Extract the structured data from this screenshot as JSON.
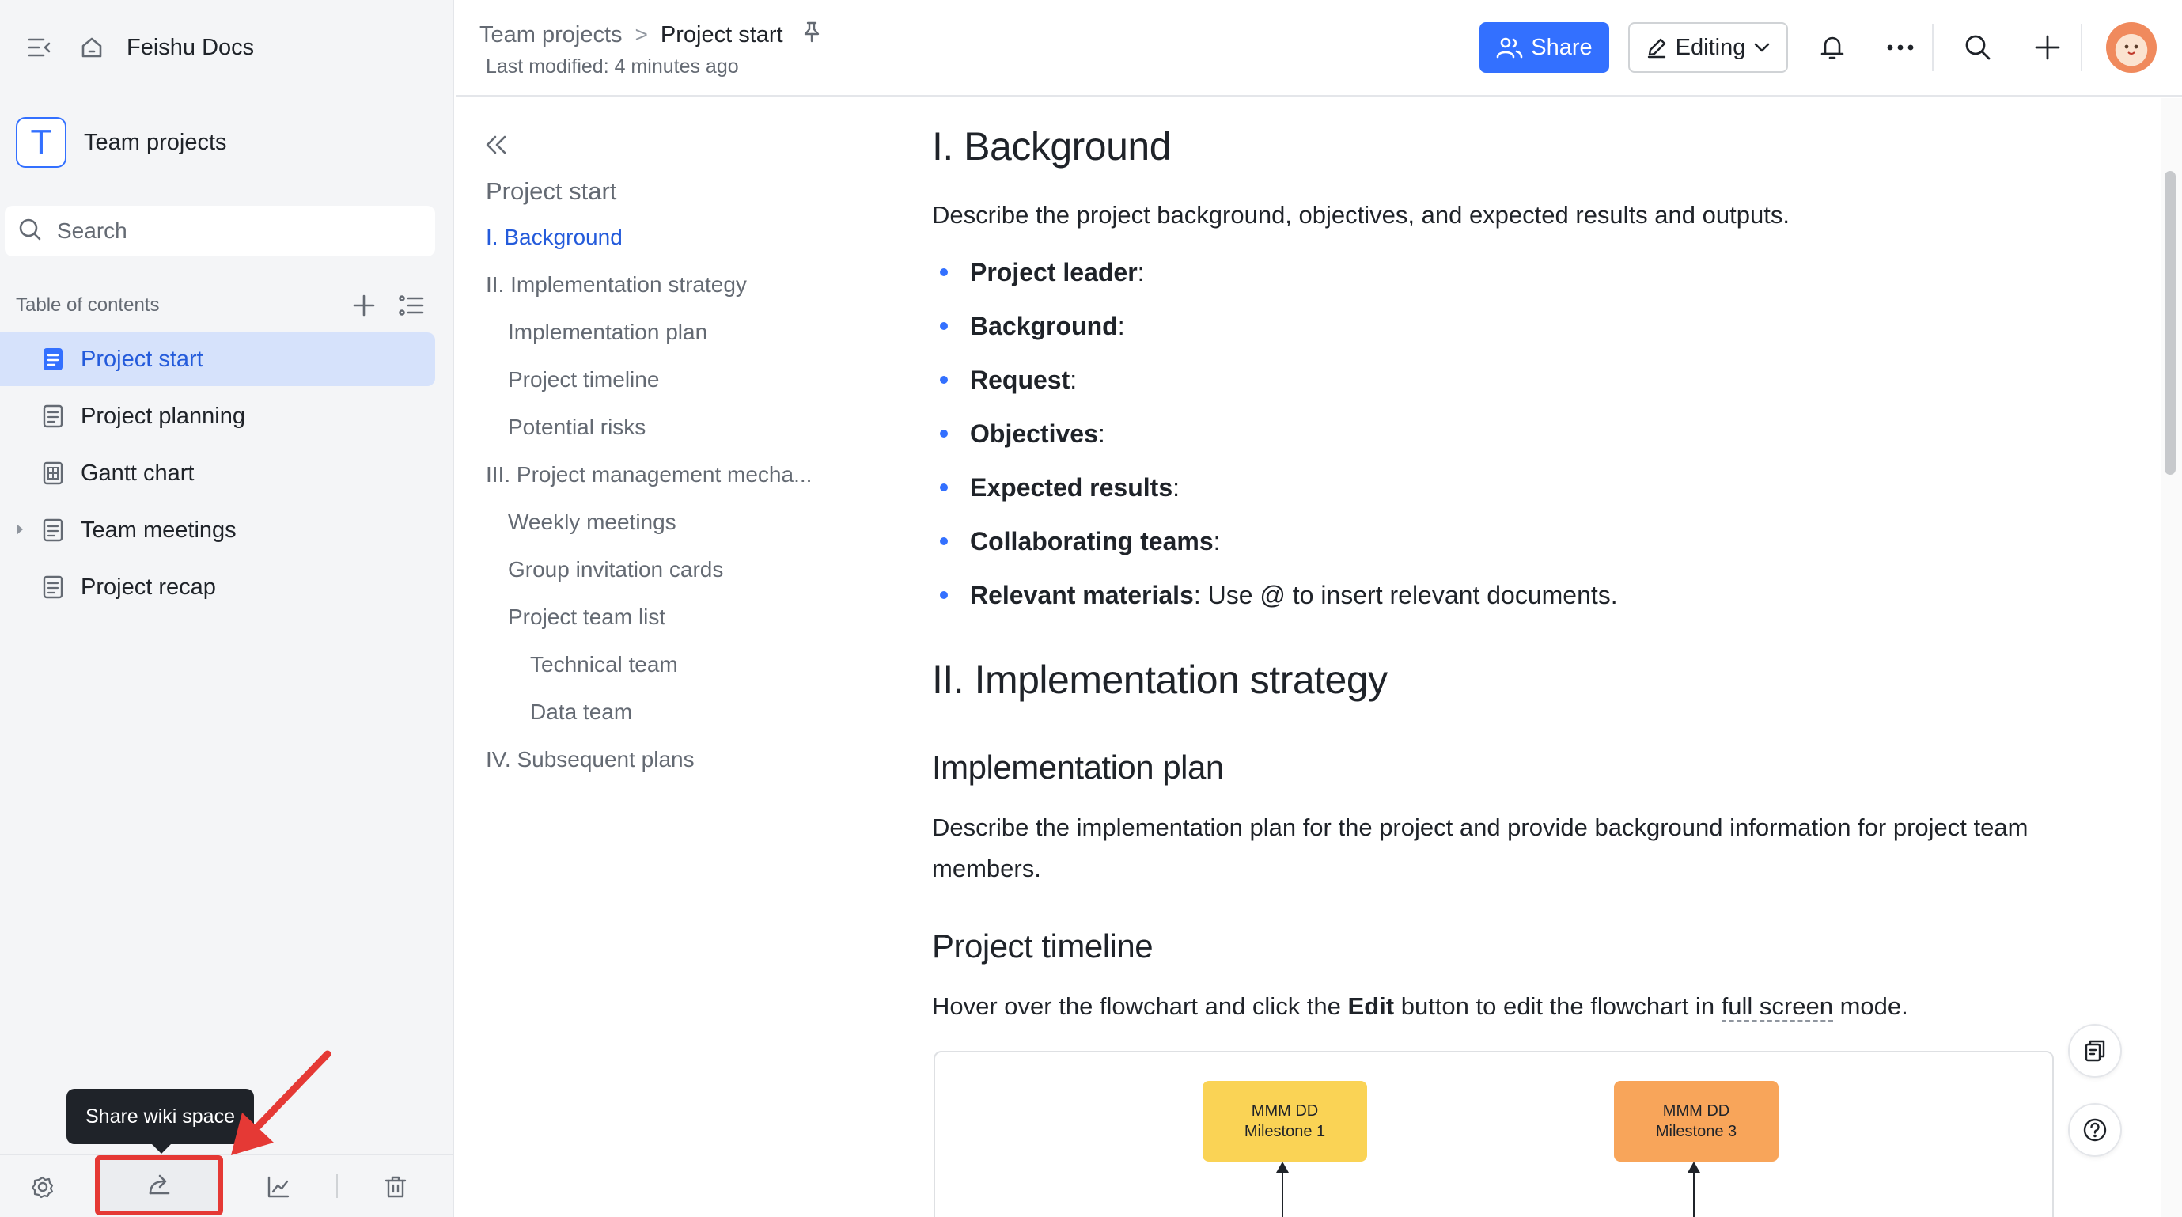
{
  "app": {
    "name": "Feishu Docs"
  },
  "sidebar": {
    "space_name": "Team projects",
    "space_initial": "T",
    "search_placeholder": "Search",
    "toc_title": "Table of contents",
    "items": [
      {
        "label": "Project start",
        "icon": "doc-icon",
        "active": true
      },
      {
        "label": "Project planning",
        "icon": "doc-icon"
      },
      {
        "label": "Gantt chart",
        "icon": "grid-icon"
      },
      {
        "label": "Team meetings",
        "icon": "doc-icon",
        "expandable": true
      },
      {
        "label": "Project recap",
        "icon": "doc-icon"
      }
    ],
    "tooltip": "Share wiki space"
  },
  "header": {
    "breadcrumb": [
      "Team projects",
      "Project start"
    ],
    "breadcrumb_sep": ">",
    "last_modified": "Last modified: 4 minutes ago",
    "share_label": "Share",
    "edit_label": "Editing"
  },
  "outline": {
    "title": "Project start",
    "items": [
      {
        "label": "I. Background",
        "level": 1,
        "active": true
      },
      {
        "label": "II. Implementation strategy",
        "level": 1
      },
      {
        "label": "Implementation plan",
        "level": 2
      },
      {
        "label": "Project timeline",
        "level": 2
      },
      {
        "label": "Potential risks",
        "level": 2
      },
      {
        "label": "III. Project management mecha...",
        "level": 1
      },
      {
        "label": "Weekly meetings",
        "level": 2
      },
      {
        "label": "Group invitation cards",
        "level": 2
      },
      {
        "label": "Project team list",
        "level": 2
      },
      {
        "label": "Technical team",
        "level": 3
      },
      {
        "label": "Data team",
        "level": 3
      },
      {
        "label": "IV. Subsequent plans",
        "level": 1
      }
    ]
  },
  "doc": {
    "h1_background": "I. Background",
    "background_intro": "Describe the project background, objectives, and expected results and outputs.",
    "bullets": [
      {
        "bold": "Project leader",
        "rest": ":"
      },
      {
        "bold": "Background",
        "rest": ":"
      },
      {
        "bold": "Request",
        "rest": ":"
      },
      {
        "bold": "Objectives",
        "rest": ":"
      },
      {
        "bold": "Expected results",
        "rest": ":"
      },
      {
        "bold": "Collaborating teams",
        "rest": ":"
      },
      {
        "bold": "Relevant materials",
        "rest": ": Use @ to insert relevant documents."
      }
    ],
    "h1_strategy": "II. Implementation strategy",
    "h2_plan": "Implementation plan",
    "plan_text": "Describe the implementation plan for the project and provide background information for project team members.",
    "h2_timeline": "Project timeline",
    "timeline_pre": "Hover over the flowchart and click the ",
    "timeline_bold": "Edit",
    "timeline_mid": " button to edit the flowchart in ",
    "timeline_link": "full screen",
    "timeline_post": " mode.",
    "milestones": [
      {
        "date": "MMM DD",
        "name": "Milestone 1",
        "color": "#fad355"
      },
      {
        "date": "MMM DD",
        "name": "Milestone 3",
        "color": "#f8a55a"
      }
    ]
  },
  "colors": {
    "accent": "#3370ff",
    "active_bg": "#d6e2fb",
    "highlight": "#e53935"
  }
}
